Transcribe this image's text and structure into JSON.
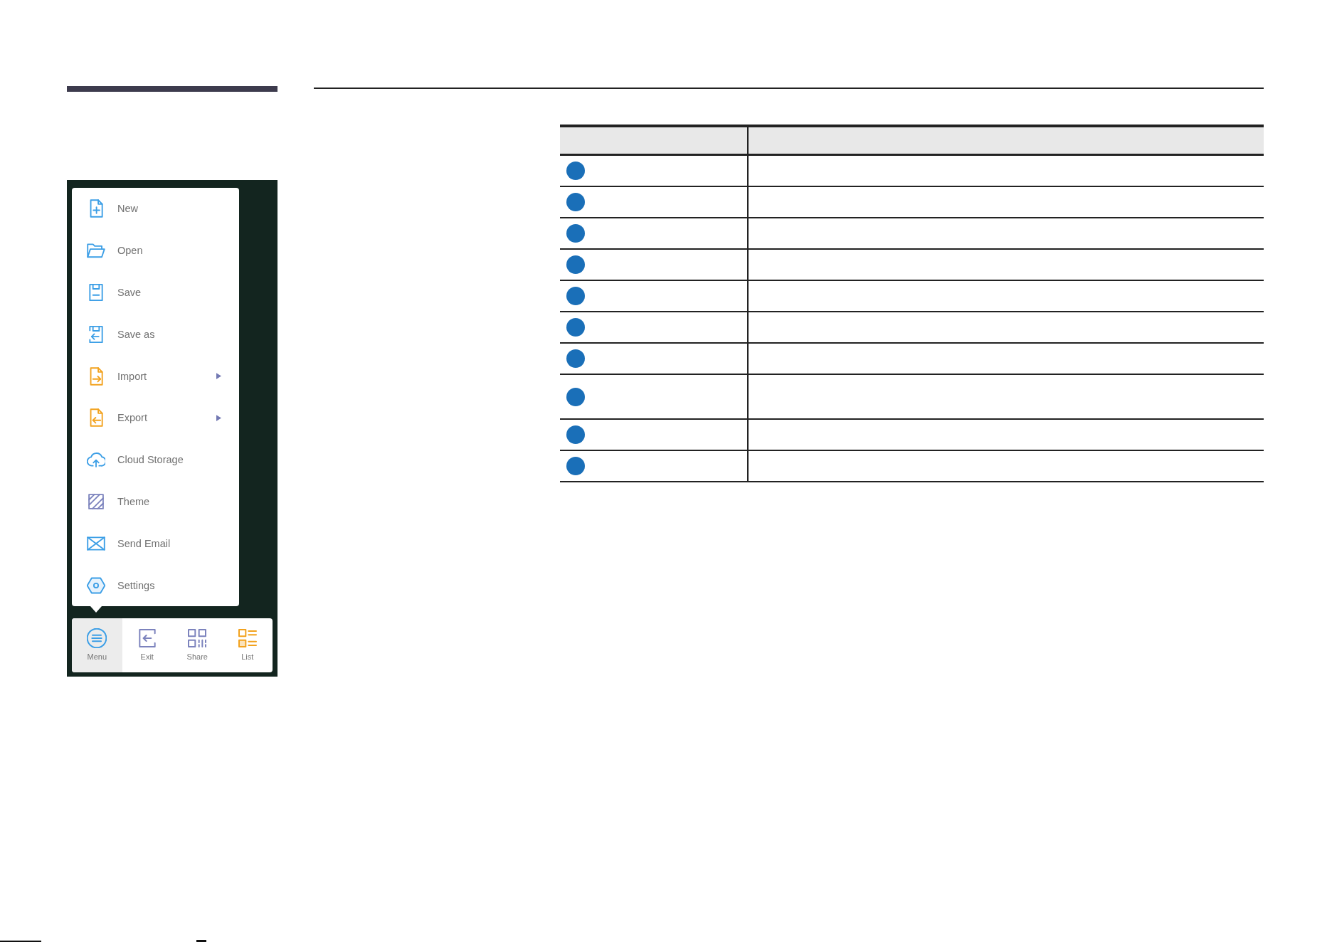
{
  "menu": {
    "items": [
      {
        "label": "New",
        "has_submenu": false
      },
      {
        "label": "Open",
        "has_submenu": false
      },
      {
        "label": "Save",
        "has_submenu": false
      },
      {
        "label": "Save as",
        "has_submenu": false
      },
      {
        "label": "Import",
        "has_submenu": true
      },
      {
        "label": "Export",
        "has_submenu": true
      },
      {
        "label": "Cloud Storage",
        "has_submenu": false
      },
      {
        "label": "Theme",
        "has_submenu": false
      },
      {
        "label": "Send Email",
        "has_submenu": false
      },
      {
        "label": "Settings",
        "has_submenu": false
      }
    ]
  },
  "toolbar": {
    "items": [
      {
        "label": "Menu",
        "selected": true
      },
      {
        "label": "Exit",
        "selected": false
      },
      {
        "label": "Share",
        "selected": false
      },
      {
        "label": "List",
        "selected": false
      }
    ]
  },
  "table": {
    "rows": [
      {
        "kind": "row"
      },
      {
        "kind": "row"
      },
      {
        "kind": "row"
      },
      {
        "kind": "row"
      },
      {
        "kind": "row"
      },
      {
        "kind": "row"
      },
      {
        "kind": "row"
      },
      {
        "kind": "tall"
      },
      {
        "kind": "row"
      },
      {
        "kind": "row"
      }
    ]
  }
}
